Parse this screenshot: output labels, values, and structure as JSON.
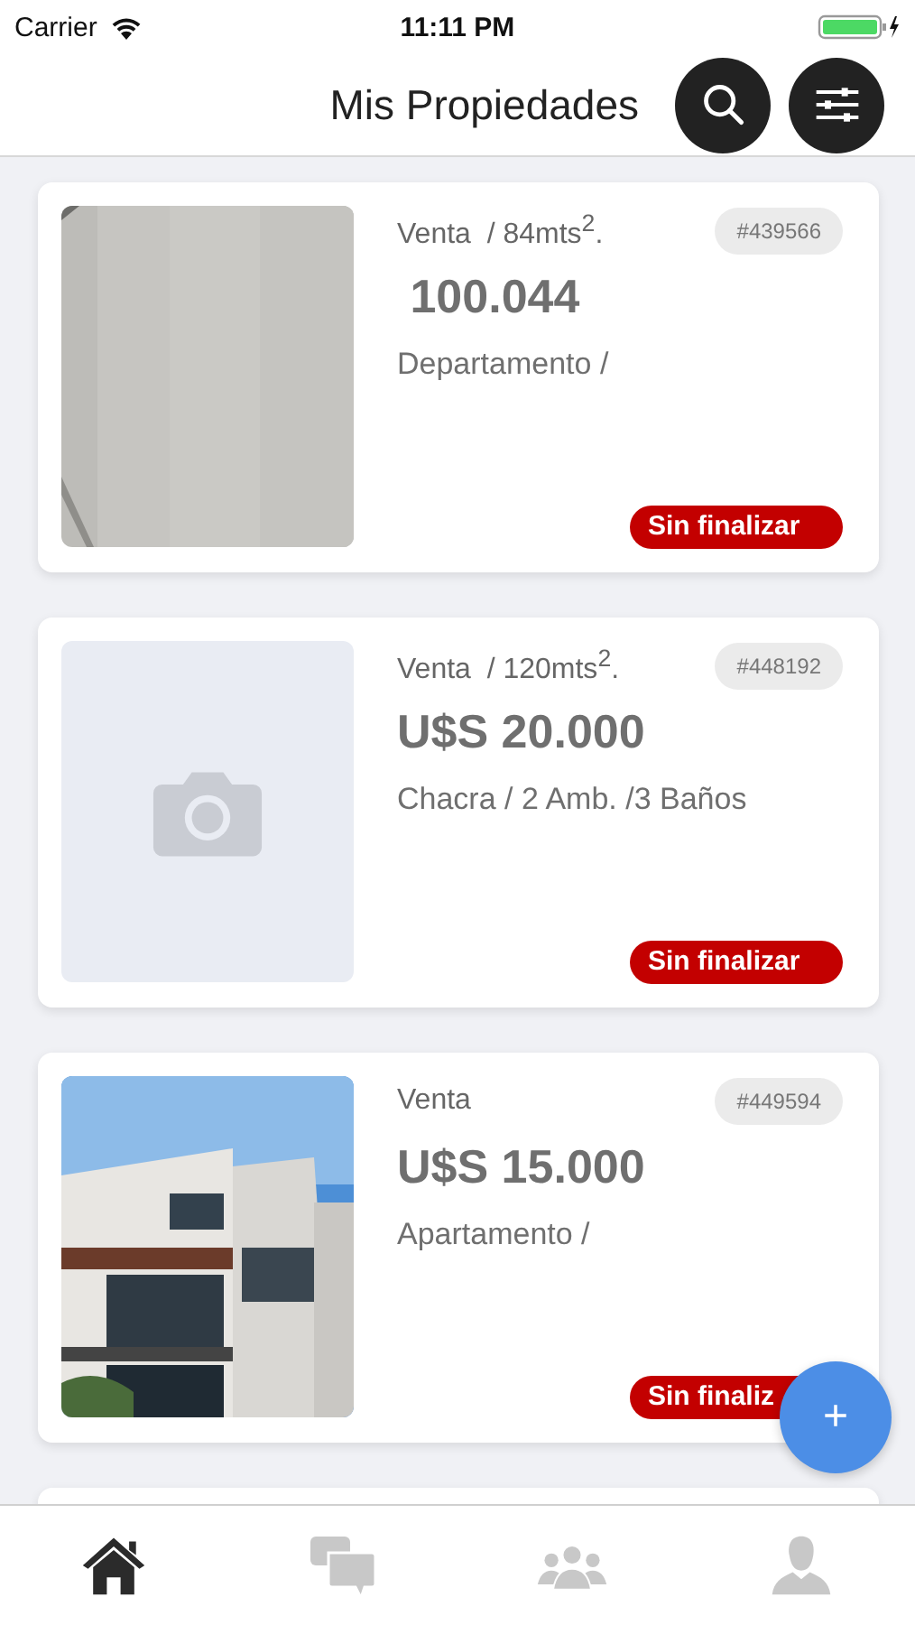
{
  "status_bar": {
    "carrier": "Carrier",
    "time": "11:11 PM"
  },
  "header": {
    "title": "Mis Propiedades"
  },
  "properties": [
    {
      "image": {
        "kind": "wall"
      },
      "summary": "Venta  / 84mts$^{2}$.",
      "code": "#439566",
      "price": " 100.044",
      "details": "Departamento /",
      "status": "Sin finalizar"
    },
    {
      "image": {
        "kind": "placeholder"
      },
      "summary": "Venta  / 120mts$^{2}$.",
      "code": "#448192",
      "price": "U$S 20.000",
      "details": "Chacra / 2 Amb. /3 Baños",
      "status": "Sin finalizar"
    },
    {
      "image": {
        "kind": "building"
      },
      "summary": "Venta",
      "code": "#449594",
      "price": "U$S 15.000",
      "details": "Apartamento /",
      "status": "Sin finaliz"
    }
  ],
  "fab": {
    "label": "+"
  },
  "tab_bar": [
    {
      "kind": "home",
      "selected": true
    },
    {
      "kind": "chat",
      "selected": false
    },
    {
      "kind": "group",
      "selected": false
    },
    {
      "kind": "profile",
      "selected": false
    }
  ]
}
